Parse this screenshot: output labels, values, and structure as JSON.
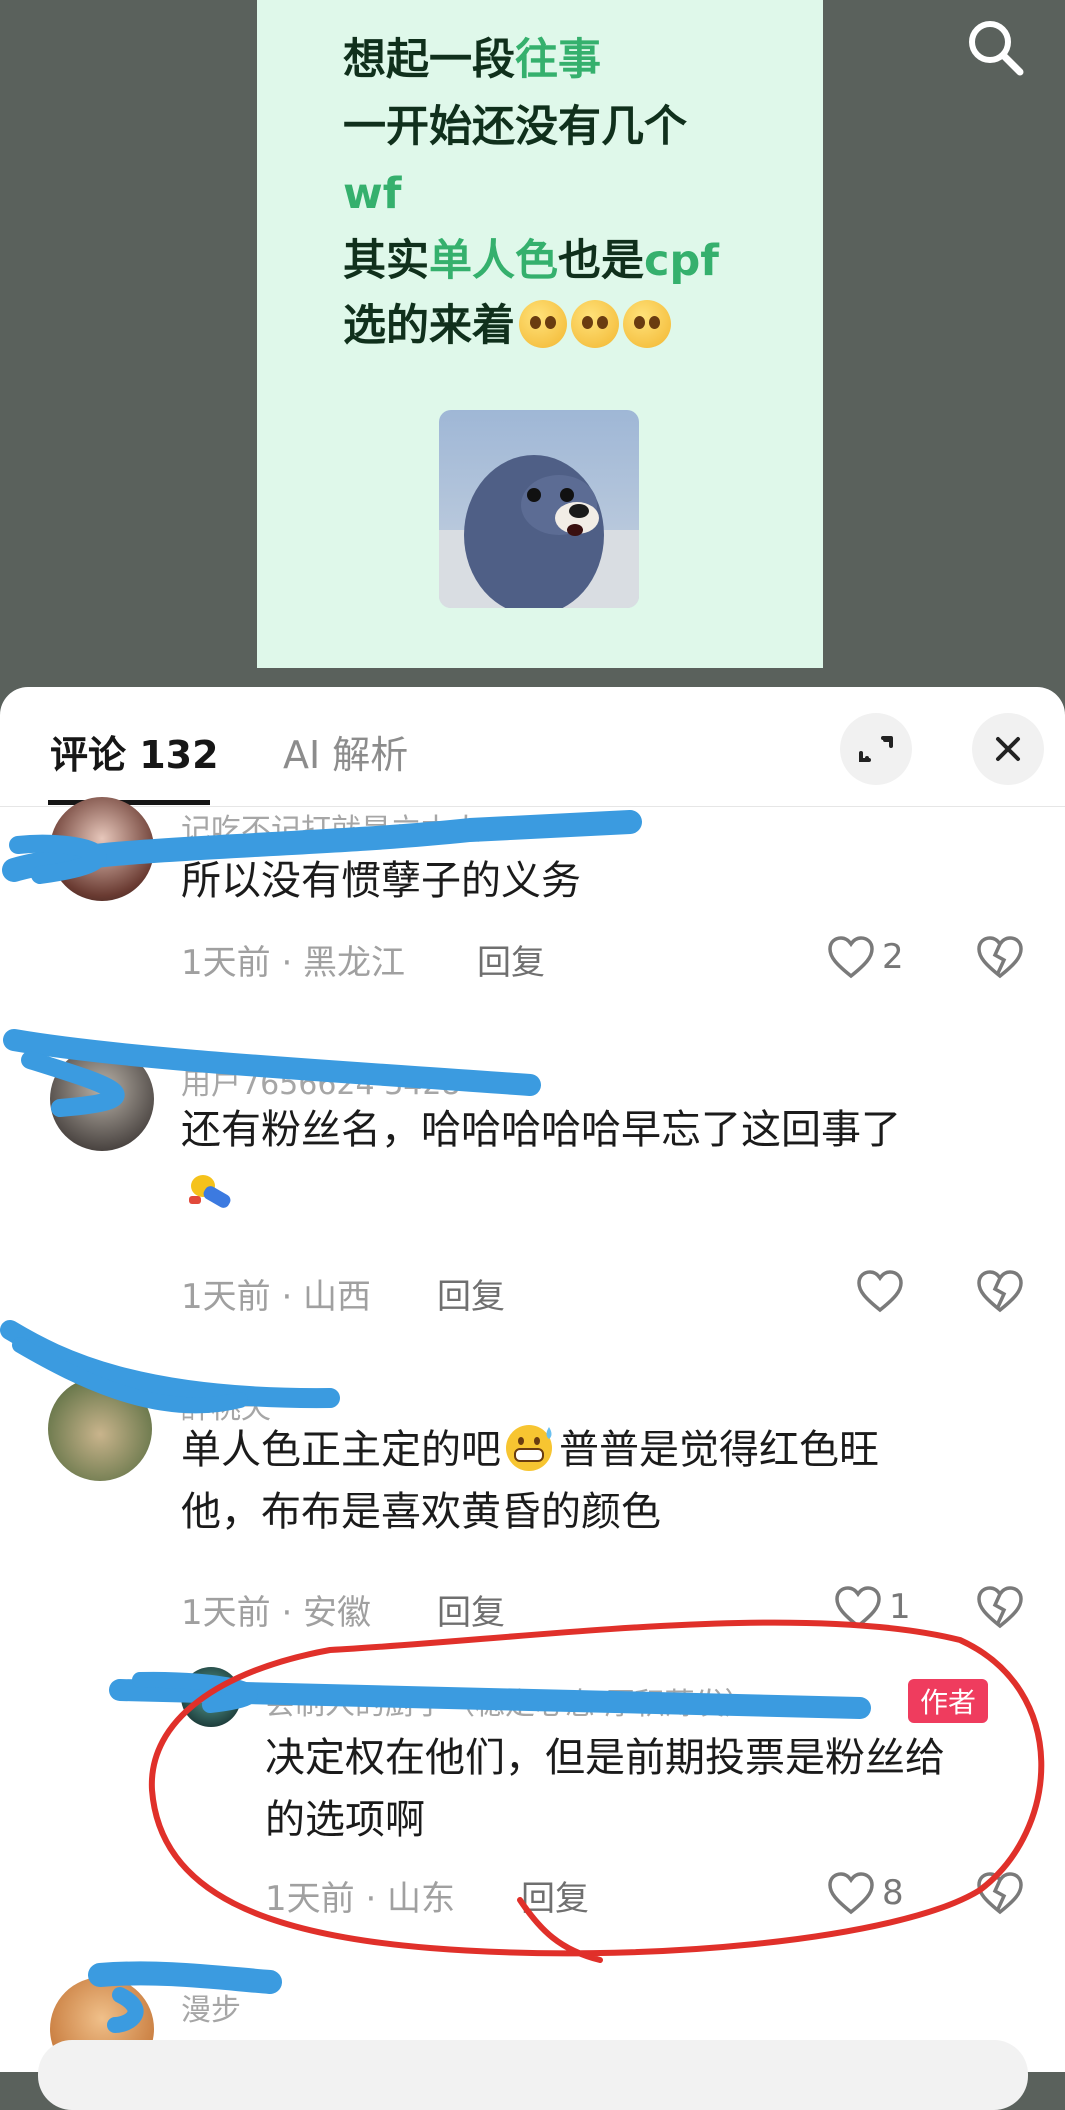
{
  "post": {
    "line1_a": "想起一段",
    "line1_b": "往事",
    "line2": "一开始还没有几个",
    "line3": "wf",
    "line4_a": "其实",
    "line4_b": "单人色",
    "line4_c": "也是",
    "line4_d": "cpf",
    "line5": "选的来着"
  },
  "sheet": {
    "tab_comments": "评论 132",
    "tab_ai": "AI 解析"
  },
  "comments": [
    {
      "username": "记吃不记打就是立本人",
      "text": "所以没有惯孽子的义务",
      "time_location": "1天前 · 黑龙江",
      "reply": "回复",
      "likes": "2"
    },
    {
      "username": "用户7656624 3428",
      "text": "还有粉丝名，哈哈哈哈哈早忘了这回事了",
      "time_location": "1天前 · 山西",
      "reply": "回复",
      "likes": ""
    },
    {
      "username": "醉桃夭",
      "text_a": "单人色正主定的吧",
      "text_b": "普普是觉得红色旺",
      "text_c": "他，布布是喜欢黄昏的颜色",
      "time_location": "1天前 · 安徽",
      "reply": "回复",
      "likes": "1"
    },
    {
      "username": "会制人的厨子（稳定心态 厚积薄发）",
      "badge": "作者",
      "text_a": "决定权在他们，但是前期投票是粉丝给",
      "text_b": "的选项啊",
      "time_location": "1天前 · 山东",
      "reply": "回复",
      "likes": "8"
    },
    {
      "username": "漫步"
    }
  ],
  "colors": {
    "accent_green": "#35b06d",
    "author_badge": "#ef3c5e",
    "annotation_red": "#e0302a",
    "scribble_blue": "#3b9be0"
  }
}
